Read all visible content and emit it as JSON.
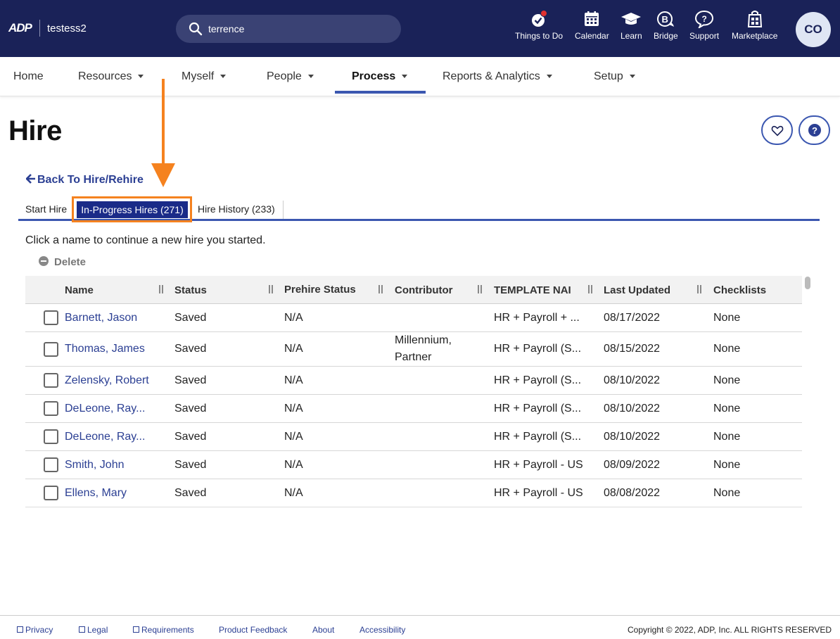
{
  "header": {
    "logo": "ADP",
    "org": "testess2",
    "search_value": "terrence",
    "icons": [
      {
        "label": "Things to Do",
        "icon": "check-badge-icon"
      },
      {
        "label": "Calendar",
        "icon": "calendar-icon"
      },
      {
        "label": "Learn",
        "icon": "graduation-cap-icon"
      },
      {
        "label": "Bridge",
        "icon": "bridge-icon"
      },
      {
        "label": "Support",
        "icon": "support-icon"
      },
      {
        "label": "Marketplace",
        "icon": "marketplace-icon"
      }
    ],
    "avatar_initials": "CO"
  },
  "nav": {
    "items": [
      "Home",
      "Resources",
      "Myself",
      "People",
      "Process",
      "Reports & Analytics",
      "Setup"
    ],
    "active": "Process"
  },
  "page": {
    "title": "Hire",
    "back_link": "Back To Hire/Rehire",
    "tabs": [
      "Start Hire",
      "In-Progress Hires (271)",
      "Hire History (233)"
    ],
    "active_tab": "In-Progress Hires (271)",
    "instruction": "Click a name to continue a new hire you started.",
    "delete_label": "Delete"
  },
  "table": {
    "columns": [
      "Name",
      "Status",
      "Prehire Status",
      "Contributor",
      "TEMPLATE NAI",
      "Last Updated",
      "Checklists"
    ],
    "rows": [
      {
        "name": "Barnett, Jason",
        "status": "Saved",
        "prehire": "N/A",
        "contributor": "",
        "template": "HR + Payroll + ...",
        "updated": "08/17/2022",
        "checklists": "None"
      },
      {
        "name": "Thomas, James",
        "status": "Saved",
        "prehire": "N/A",
        "contributor": "Millennium, Partner",
        "template": "HR + Payroll (S...",
        "updated": "08/15/2022",
        "checklists": "None"
      },
      {
        "name": "Zelensky, Robert",
        "status": "Saved",
        "prehire": "N/A",
        "contributor": "",
        "template": "HR + Payroll (S...",
        "updated": "08/10/2022",
        "checklists": "None"
      },
      {
        "name": "DeLeone, Ray...",
        "status": "Saved",
        "prehire": "N/A",
        "contributor": "",
        "template": "HR + Payroll (S...",
        "updated": "08/10/2022",
        "checklists": "None"
      },
      {
        "name": "DeLeone, Ray...",
        "status": "Saved",
        "prehire": "N/A",
        "contributor": "",
        "template": "HR + Payroll (S...",
        "updated": "08/10/2022",
        "checklists": "None"
      },
      {
        "name": "Smith, John",
        "status": "Saved",
        "prehire": "N/A",
        "contributor": "",
        "template": "HR + Payroll - US",
        "updated": "08/09/2022",
        "checklists": "None"
      },
      {
        "name": "Ellens, Mary",
        "status": "Saved",
        "prehire": "N/A",
        "contributor": "",
        "template": "HR + Payroll - US",
        "updated": "08/08/2022",
        "checklists": "None"
      }
    ]
  },
  "footer": {
    "links": [
      "Privacy",
      "Legal",
      "Requirements",
      "Product Feedback",
      "About",
      "Accessibility"
    ],
    "copyright": "Copyright © 2022, ADP, Inc. ALL RIGHTS RESERVED"
  },
  "colors": {
    "header_bg": "#1a2258",
    "accent": "#3b57b0",
    "link": "#2b3f93",
    "annotation": "#f5821f"
  }
}
